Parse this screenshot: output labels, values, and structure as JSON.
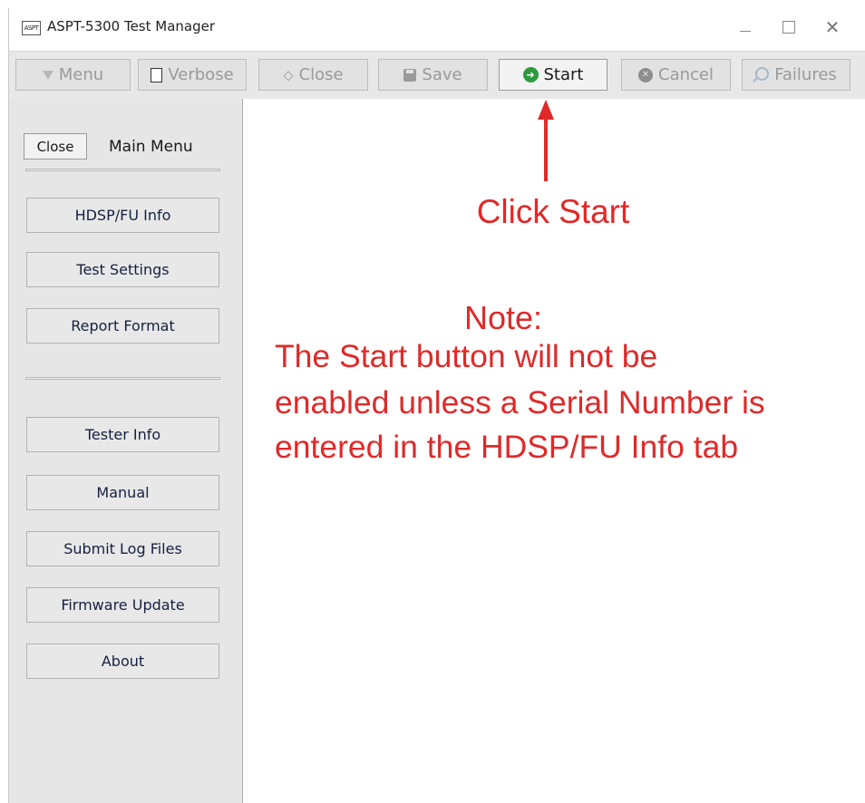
{
  "window": {
    "app_icon_text": "ASPT",
    "title": "ASPT-5300 Test Manager",
    "minimize_icon": "minimize-icon",
    "maximize_icon": "maximize-icon",
    "close_icon": "close-icon",
    "close_glyph": "✕"
  },
  "toolbar": {
    "menu": {
      "label": "Menu",
      "enabled": false,
      "icon": "triangle-down-icon"
    },
    "verbose": {
      "label": "Verbose",
      "enabled": false,
      "icon": "checkbox-icon"
    },
    "close": {
      "label": "Close",
      "enabled": false,
      "icon": "tag-icon",
      "glyph": "⬦"
    },
    "save": {
      "label": "Save",
      "enabled": false,
      "icon": "floppy-disk-icon"
    },
    "start": {
      "label": "Start",
      "enabled": true,
      "icon": "green-arrow-circle-icon",
      "glyph": "➜"
    },
    "cancel": {
      "label": "Cancel",
      "enabled": false,
      "icon": "x-circle-icon",
      "glyph": "✕"
    },
    "failures": {
      "label": "Failures",
      "enabled": false,
      "icon": "magnifier-icon"
    }
  },
  "sidebar": {
    "close_label": "Close",
    "title": "Main Menu",
    "items": [
      {
        "label": "HDSP/FU Info"
      },
      {
        "label": "Test Settings"
      },
      {
        "label": "Report Format"
      },
      {
        "label": "Tester Info"
      },
      {
        "label": "Manual"
      },
      {
        "label": "Submit Log Files"
      },
      {
        "label": "Firmware Update"
      },
      {
        "label": "About"
      }
    ]
  },
  "annotation": {
    "click_start": "Click Start",
    "note_title": "Note:",
    "note_lines": [
      "The Start button will not be",
      "enabled unless a Serial Number is",
      "entered in the HDSP/FU Info tab"
    ],
    "color": "#e02929"
  }
}
